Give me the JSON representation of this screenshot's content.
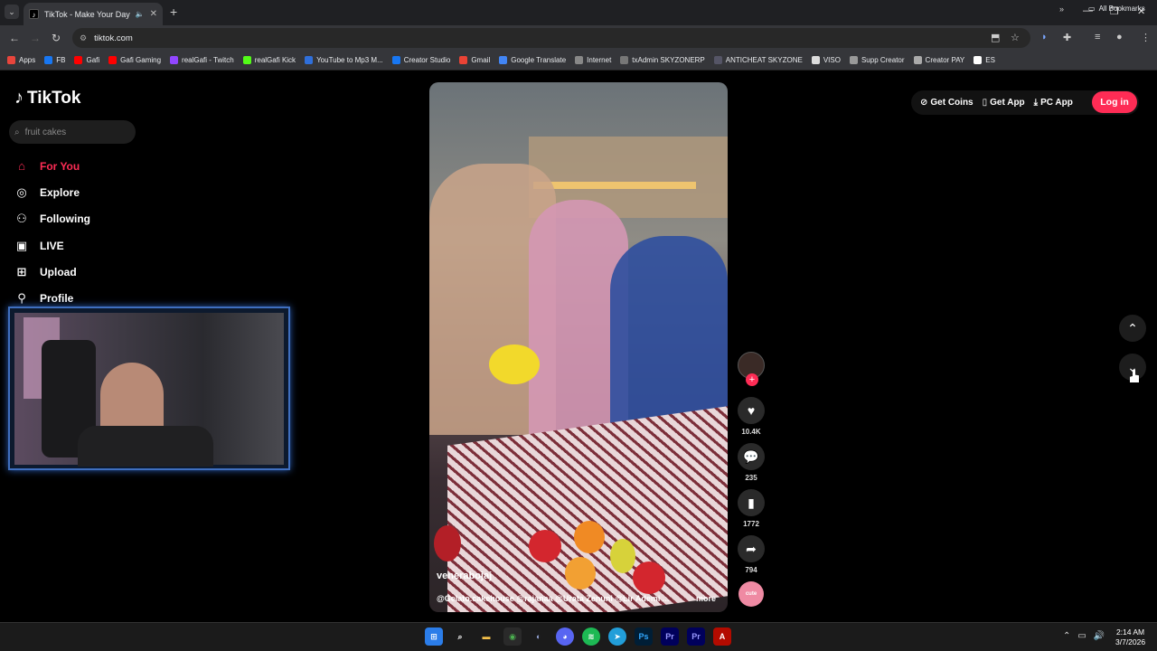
{
  "browser": {
    "tab_title": "TikTok - Make Your Day",
    "url": "tiktok.com",
    "bookmarks": [
      "Apps",
      "FB",
      "Gafi",
      "Gafi Gaming",
      "realGafi - Twitch",
      "realGafi Kick",
      "YouTube to Mp3 M...",
      "Creator Studio",
      "Gmail",
      "Google Translate",
      "Internet",
      "txAdmin SKYZONERP",
      "ANTICHEAT SKYZONE",
      "VISO",
      "Supp Creator",
      "Creator PAY",
      "ES"
    ],
    "all_bookmarks": "All Bookmarks"
  },
  "tiktok": {
    "logo": "TikTok",
    "search_placeholder": "fruit cakes",
    "nav": [
      {
        "label": "For You",
        "icon": "home-icon"
      },
      {
        "label": "Explore",
        "icon": "compass-icon"
      },
      {
        "label": "Following",
        "icon": "following-icon"
      },
      {
        "label": "LIVE",
        "icon": "live-icon"
      },
      {
        "label": "Upload",
        "icon": "upload-icon"
      },
      {
        "label": "Profile",
        "icon": "profile-icon"
      }
    ],
    "header": {
      "get_coins": "Get Coins",
      "get_app": "Get App",
      "pc_app": "PC App",
      "login": "Log in"
    },
    "video": {
      "handle": "venerabojaj",
      "caption": "@Gelato.cakehouse @rajanaa @Urata Zenuni @Lir Ademi ...",
      "more": "more"
    },
    "actions": {
      "likes": "10.4K",
      "comments": "235",
      "saves": "1772",
      "shares": "794",
      "music_label": "cute"
    }
  },
  "taskbar": {
    "time": "2:14 AM",
    "date": "3/7/2026"
  },
  "colors": {
    "accent": "#fe2c55",
    "background": "#000000"
  }
}
